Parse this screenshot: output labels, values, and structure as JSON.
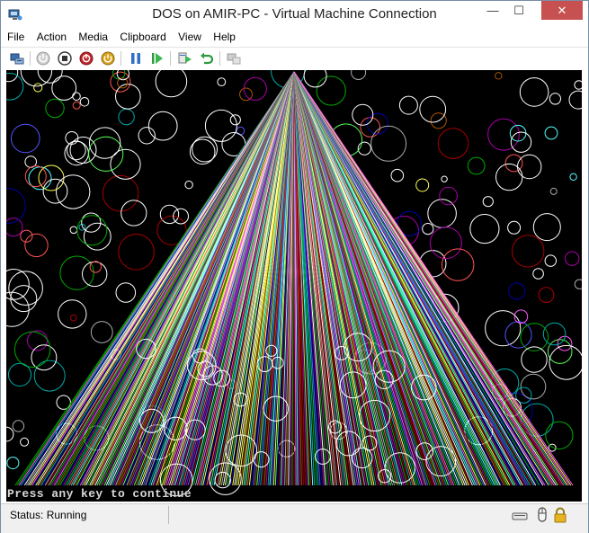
{
  "window": {
    "title": "DOS on AMIR-PC - Virtual Machine Connection",
    "minimize_glyph": "—",
    "maximize_glyph": "☐",
    "close_glyph": "✕"
  },
  "menu": {
    "items": [
      "File",
      "Action",
      "Media",
      "Clipboard",
      "View",
      "Help"
    ]
  },
  "toolbar": {
    "buttons": [
      "ctrl-alt-del-icon",
      "start-icon",
      "turn-off-icon",
      "shut-down-icon",
      "power-icon",
      "pause-icon",
      "resume-icon",
      "save-state-icon",
      "revert-icon",
      "enhanced-session-icon"
    ]
  },
  "screen": {
    "console_line": "Press any key to continue",
    "background": "#000000",
    "fan_colors": [
      "#ffffff",
      "#ff5555",
      "#55ff55",
      "#5555ff",
      "#ff55ff",
      "#55ffff",
      "#ffff55",
      "#aaaaaa",
      "#aa0000",
      "#00aa00",
      "#0000aa",
      "#aa00aa",
      "#00aaaa",
      "#aa5500"
    ]
  },
  "status": {
    "text": "Status: Running"
  }
}
